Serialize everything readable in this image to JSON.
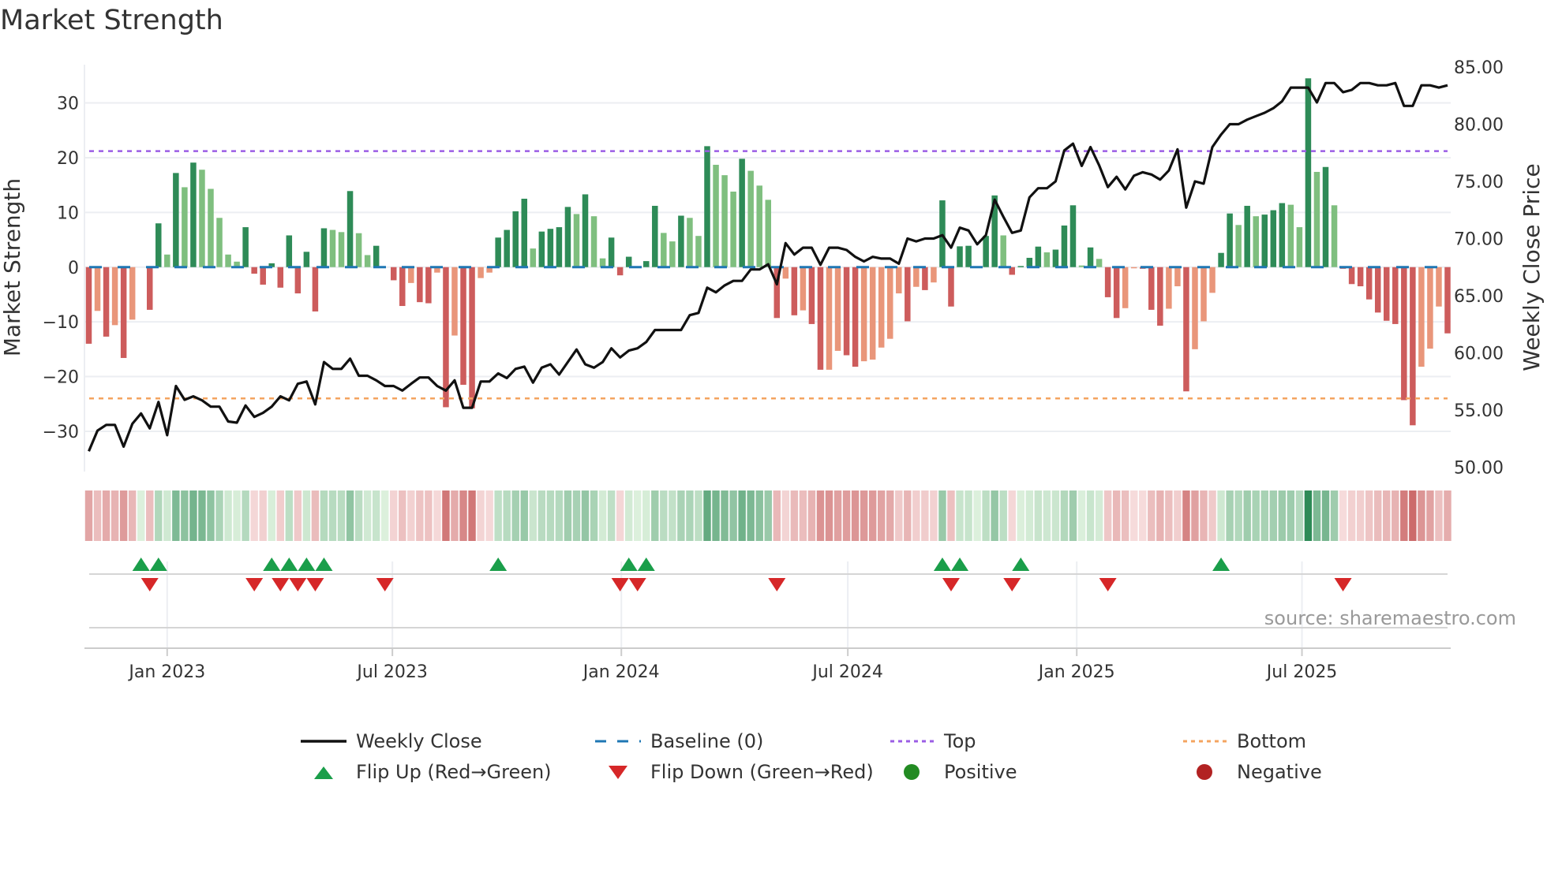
{
  "title": "Market Strength",
  "source": "source: sharemaestro.com",
  "colors": {
    "pos_dark": "#2e8b57",
    "pos_light": "#7fbf7f",
    "neg_dark": "#cd5c5c",
    "neg_light": "#e9967a",
    "baseline": "#1f77b4",
    "top": "#9b5de5",
    "bottom": "#f4a460",
    "flip_up": "#1a9e4a",
    "flip_down": "#d62728",
    "positive": "#228b22",
    "negative": "#b22222",
    "close": "#111111"
  },
  "legend": [
    {
      "key": "close",
      "label": "Weekly Close"
    },
    {
      "key": "baseline",
      "label": "Baseline (0)"
    },
    {
      "key": "top",
      "label": "Top"
    },
    {
      "key": "bottom",
      "label": "Bottom"
    },
    {
      "key": "flip_up",
      "label": "Flip Up (Red→Green)"
    },
    {
      "key": "flip_down",
      "label": "Flip Down (Green→Red)"
    },
    {
      "key": "positive",
      "label": "Positive"
    },
    {
      "key": "negative",
      "label": "Negative"
    }
  ],
  "chart_data": {
    "type": "bar",
    "title": "Market Strength",
    "ylabel": "Market Strength",
    "y2label": "Weekly Close Price",
    "ylim": [
      -36,
      36
    ],
    "y2lim": [
      50,
      85
    ],
    "yticks": [
      {
        "v": -30,
        "label": "−30"
      },
      {
        "v": -20,
        "label": "−20"
      },
      {
        "v": -10,
        "label": "−10"
      },
      {
        "v": 0,
        "label": "0"
      },
      {
        "v": 10,
        "label": "10"
      },
      {
        "v": 20,
        "label": "20"
      },
      {
        "v": 30,
        "label": "30"
      }
    ],
    "y2ticks": [
      {
        "v": 50,
        "label": "50.00"
      },
      {
        "v": 55,
        "label": "55.00"
      },
      {
        "v": 60,
        "label": "60.00"
      },
      {
        "v": 65,
        "label": "65.00"
      },
      {
        "v": 70,
        "label": "70.00"
      },
      {
        "v": 75,
        "label": "75.00"
      },
      {
        "v": 80,
        "label": "80.00"
      },
      {
        "v": 85,
        "label": "85.00"
      }
    ],
    "xticks": [
      {
        "date": "2023-01-01",
        "label": "Jan 2023"
      },
      {
        "date": "2023-07-01",
        "label": "Jul 2023"
      },
      {
        "date": "2024-01-01",
        "label": "Jan 2024"
      },
      {
        "date": "2024-07-01",
        "label": "Jul 2024"
      },
      {
        "date": "2025-01-01",
        "label": "Jan 2025"
      },
      {
        "date": "2025-07-01",
        "label": "Jul 2025"
      }
    ],
    "start_date": "2022-10-30",
    "frequency": "weekly",
    "top_level": 21.2,
    "bottom_level": -24.0,
    "baseline": 0,
    "strength": [
      -14,
      -8,
      -12.7,
      -10.6,
      -16.6,
      -9.6,
      0,
      -7.8,
      8,
      2.3,
      17.2,
      14.6,
      19.1,
      17.8,
      14.3,
      9,
      2.3,
      1,
      7.3,
      -1.2,
      -3.2,
      0.7,
      -3.75,
      5.8,
      -4.8,
      2.8,
      -8.1,
      7.1,
      6.8,
      6.4,
      13.9,
      6.2,
      2.2,
      3.9,
      0,
      -2.4,
      -7.1,
      -2.9,
      -6.4,
      -6.6,
      -1,
      -25.6,
      -12.5,
      -21.5,
      -25.8,
      -2,
      -1,
      5.4,
      6.8,
      10.2,
      12.5,
      3.4,
      6.5,
      7,
      7.3,
      11,
      9.7,
      13.3,
      9.3,
      1.6,
      5.4,
      -1.5,
      1.9,
      0,
      1.1,
      11.2,
      6.25,
      4.7,
      9.4,
      9,
      5.7,
      22.1,
      18.7,
      16.8,
      13.8,
      19.8,
      17.6,
      14.9,
      12.3,
      -9.3,
      -2.1,
      -8.8,
      -7.9,
      -10.4,
      -18.75,
      -18.75,
      -15.3,
      -16.1,
      -18.2,
      -17.2,
      -16.9,
      -14.7,
      -13.1,
      -4.8,
      -9.9,
      -3.6,
      -4.2,
      -2.8,
      12.2,
      -7.2,
      3.8,
      3.9,
      0,
      5.7,
      13.1,
      5.8,
      -1.4,
      0.2,
      1.7,
      3.75,
      2.7,
      3.2,
      7.6,
      11.3,
      0.3,
      3.6,
      1.5,
      -5.5,
      -9.3,
      -7.5,
      -0.2,
      -0.3,
      -7.8,
      -10.7,
      -7.6,
      -3.5,
      -22.7,
      -15,
      -9.9,
      -4.7,
      2.6,
      9.8,
      7.7,
      11.2,
      9.3,
      9.6,
      10.4,
      11.7,
      11.4,
      7.3,
      34.5,
      17.4,
      18.3,
      11.3,
      -0.3,
      -3.1,
      -3.5,
      -5.9,
      -8.3,
      -9.8,
      -10.4,
      -24.3,
      -28.9,
      -18.2,
      -14.9,
      -7.2,
      -12.1
    ],
    "tones": "DLDLDLDDDLDLDLLLLLDDDDDDDDDDLLDLLDDDDLDDLDLDDLLDDDDLDDDDLDLLDDDDDDLLDLLDLLLDLLLDLDLDDLLDDLLLLLDLDLDDDDDDDLDDDDLDDDLDLDDLLDDDLLDLLLDDLDLDDDLLDLDLDDDDDDDDDLLLD",
    "close": [
      51.4,
      53.2,
      53.7,
      53.7,
      51.8,
      53.8,
      54.7,
      53.4,
      55.7,
      52.8,
      57.1,
      55.9,
      56.2,
      55.85,
      55.3,
      55.3,
      54.0,
      53.9,
      55.4,
      54.4,
      54.75,
      55.3,
      56.2,
      55.85,
      57.3,
      57.5,
      55.5,
      59.2,
      58.6,
      58.6,
      59.5,
      58.0,
      58.0,
      57.6,
      57.1,
      57.1,
      56.7,
      57.3,
      57.85,
      57.85,
      57.1,
      56.7,
      57.6,
      55.2,
      55.2,
      57.5,
      57.5,
      58.2,
      57.8,
      58.6,
      58.8,
      57.4,
      58.7,
      59.0,
      58.1,
      59.2,
      60.3,
      59.0,
      58.7,
      59.2,
      60.4,
      59.6,
      60.2,
      60.4,
      60.95,
      62.0,
      62.0,
      62.0,
      62.0,
      63.3,
      63.5,
      65.7,
      65.3,
      65.9,
      66.3,
      66.3,
      67.3,
      67.3,
      67.75,
      66.0,
      69.6,
      68.6,
      69.2,
      69.2,
      67.7,
      69.2,
      69.2,
      69.0,
      68.4,
      68.0,
      68.4,
      68.25,
      68.25,
      67.8,
      70.0,
      69.75,
      70.0,
      70.0,
      70.3,
      69.2,
      70.95,
      70.7,
      69.5,
      70.3,
      73.4,
      71.9,
      70.5,
      70.7,
      73.6,
      74.4,
      74.4,
      75.0,
      77.7,
      78.3,
      76.35,
      78.0,
      76.4,
      74.5,
      75.4,
      74.3,
      75.5,
      75.8,
      75.6,
      75.15,
      75.95,
      77.8,
      72.7,
      75.0,
      74.8,
      78.0,
      79.1,
      80.0,
      80.0,
      80.4,
      80.7,
      81.0,
      81.4,
      82.0,
      83.2,
      83.2,
      83.2,
      81.9,
      83.6,
      83.6,
      82.8,
      83.0,
      83.6,
      83.6,
      83.4,
      83.4,
      83.6,
      81.6,
      81.6,
      83.4,
      83.4,
      83.2,
      83.4
    ],
    "flip_up_weeks": [
      6,
      8,
      21,
      23,
      25,
      27,
      47,
      62,
      64,
      98,
      100,
      107,
      130
    ],
    "flip_down_weeks": [
      7,
      19,
      22,
      24,
      26,
      34,
      61,
      63,
      79,
      99,
      106,
      117,
      144
    ],
    "grid": true,
    "legend_position": "bottom"
  }
}
